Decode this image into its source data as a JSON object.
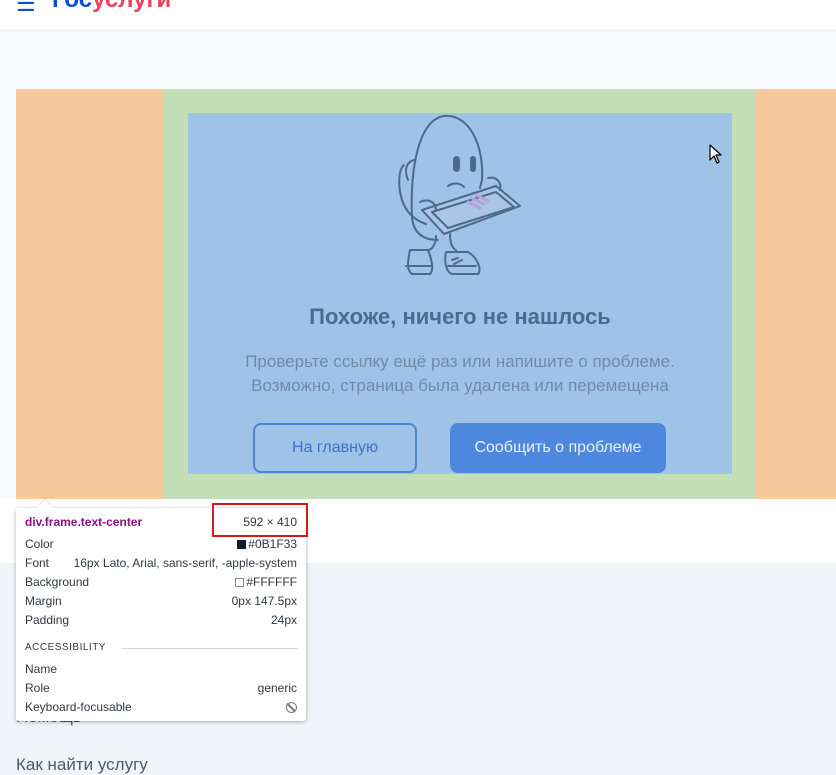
{
  "header": {
    "menu_icon": "hamburger-icon",
    "logo_part1": "Гос",
    "logo_part2": "услуги",
    "brand_blue": "#0d4cd3",
    "brand_red": "#ee3f58"
  },
  "error_page": {
    "title": "Похоже, ничего не нашлось",
    "subtitle_line1": "Проверьте ссылку ещё раз или напишите о проблеме.",
    "subtitle_line2": "Возможно, страница была удалена или перемещена",
    "home_button": "На главную",
    "report_button": "Сообщить о проблеме",
    "illustration": "confused-ghost-with-tablet-illustration"
  },
  "inspector_tooltip": {
    "selector": "div.frame.text-center",
    "size": "592 × 410",
    "rows": [
      {
        "label": "Color",
        "value": "#0B1F33"
      },
      {
        "label": "Font",
        "value": "16px Lato, Arial, sans-serif, -apple-system"
      },
      {
        "label": "Background",
        "value": "#FFFFFF"
      },
      {
        "label": "Margin",
        "value": "0px 147.5px"
      },
      {
        "label": "Padding",
        "value": "24px"
      }
    ],
    "section": "ACCESSIBILITY",
    "a11y_rows": [
      {
        "label": "Name",
        "value": ""
      },
      {
        "label": "Role",
        "value": "generic"
      },
      {
        "label": "Keyboard-focusable",
        "value": ""
      }
    ],
    "highlight_colors": {
      "margin": "#f6ca9c",
      "padding": "#c4dfb8",
      "content": "#9fc3e7"
    }
  },
  "footer": {
    "link1": "Помощь",
    "link2": "Как найти услугу"
  }
}
